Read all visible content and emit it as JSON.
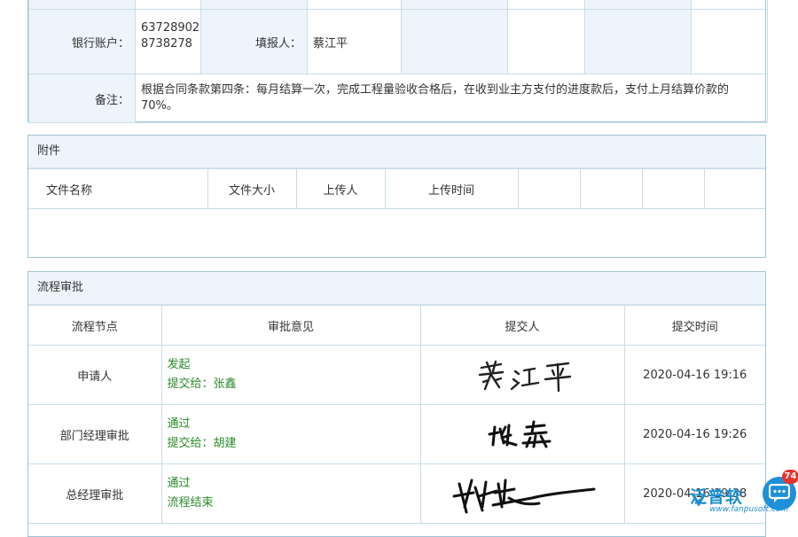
{
  "info_table": {
    "bank_account_label": "银行账户：",
    "bank_account_value_line1": "63728902",
    "bank_account_value_line2": "8738278",
    "reporter_label": "填报人：",
    "reporter_value": "蔡江平",
    "remark_label": "备注：",
    "remark_value": "根据合同条款第四条：每月结算一次，完成工程量验收合格后，在收到业主方支付的进度款后，支付上月结算价款的70%。"
  },
  "attachments": {
    "title": "附件",
    "columns": [
      "文件名称",
      "文件大小",
      "上传人",
      "上传时间",
      "",
      "",
      "",
      ""
    ]
  },
  "workflow": {
    "title": "流程审批",
    "columns": [
      "流程节点",
      "审批意见",
      "提交人",
      "提交时间"
    ],
    "rows": [
      {
        "node": "申请人",
        "opinion_line1": "发起",
        "opinion_line2": "提交给：张鑫",
        "signature": "蔡江平",
        "time": "2020-04-16 19:16"
      },
      {
        "node": "部门经理审批",
        "opinion_line1": "通过",
        "opinion_line2": "提交给：胡建",
        "signature": "张鑫",
        "time": "2020-04-16 19:26"
      },
      {
        "node": "总经理审批",
        "opinion_line1": "通过",
        "opinion_line2": "流程结束",
        "signature": "胡建",
        "time": "2020-04-16 19:38"
      }
    ]
  },
  "widgets": {
    "chat_badge_count": "74",
    "logo_text": "泛普软",
    "logo_url": "www.fanpusoft.com",
    "accent_color": "#1e90d8",
    "badge_color": "#e8322b",
    "chat_icon": "chat-bubble-icon"
  }
}
